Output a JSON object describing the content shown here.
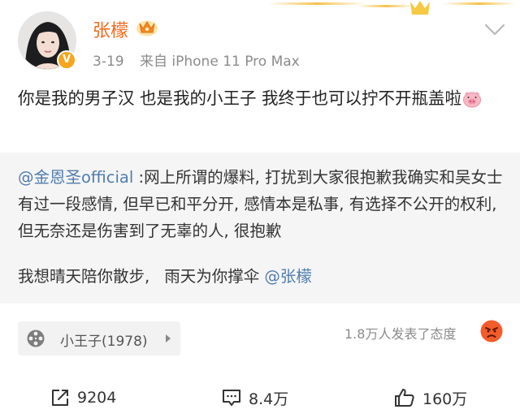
{
  "post": {
    "username": "张檬",
    "date": "3-19",
    "source": "来自 iPhone 11 Pro Max",
    "text": "你是我的男子汉  也是我的小王子  我终于也可以拧不开瓶盖啦"
  },
  "repost": {
    "mention_handle": "@金恩圣official",
    "body": " :网上所谓的爆料, 打扰到大家很抱歉我确实和吴女士有过一段感情, 但早已和平分开, 感情本是私事, 有选择不公开的权利, 但无奈还是伤害到了无辜的人, 很抱歉",
    "line2_part1": "我想晴天陪你散步,",
    "line2_part2": "雨天为你撑伞",
    "line2_mention": "@张檬"
  },
  "media": {
    "title": "小王子(1978)",
    "icon": "film-reel-icon"
  },
  "reactions": {
    "text": "1.8万人发表了态度",
    "icon": "angry-face-icon"
  },
  "actions": {
    "share_count": "9204",
    "comment_count": "8.4万",
    "like_count": "160万"
  },
  "colors": {
    "username": "#f26a1b",
    "mention": "#507daf",
    "repost_bg": "#f5f5f5",
    "verified": "#f7a51c"
  }
}
